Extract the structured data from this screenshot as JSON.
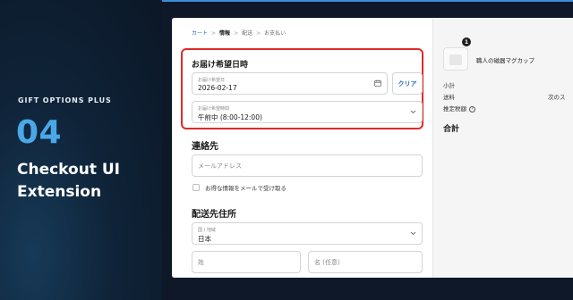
{
  "promo": {
    "eyebrow": "GIFT OPTIONS PLUS",
    "number": "04",
    "headline_line1": "Checkout UI",
    "headline_line2": "Extension"
  },
  "breadcrumb": {
    "cart": "カート",
    "info": "情報",
    "shipping": "配送",
    "payment": "お支払い",
    "separator": ">"
  },
  "delivery": {
    "title": "お届け希望日時",
    "date_label": "お届け希望日",
    "date_value": "2026-02-17",
    "clear_label": "クリア",
    "time_label": "お届け希望時間",
    "time_value": "午前中 (8:00-12:00)"
  },
  "contact": {
    "title": "連絡先",
    "email_placeholder": "メールアドレス",
    "newsletter_label": "お得な情報をメールで受け取る"
  },
  "shipping": {
    "title": "配送先住所",
    "country_label": "国 / 地域",
    "country_value": "日本",
    "last_name_placeholder": "姓",
    "first_name_placeholder": "名 (任意)"
  },
  "summary": {
    "quantity_badge": "1",
    "product_name": "職人の磁器マグカップ",
    "subtotal_label": "小計",
    "shipping_label": "送料",
    "shipping_value": "次のス",
    "tax_label": "推定税額",
    "total_label": "合計"
  },
  "icons": {
    "calendar": "calendar-icon",
    "chevron": "chevron-down-icon",
    "info": "info-icon"
  },
  "colors": {
    "accent": "#4aa8e8",
    "link": "#2a6cb8",
    "highlight": "#e02a2a"
  }
}
